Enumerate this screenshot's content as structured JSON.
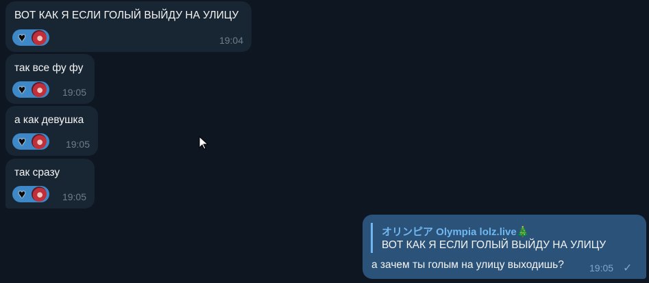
{
  "messages_in": [
    {
      "text": "ВОТ КАК Я ЕСЛИ ГОЛЫЙ ВЫЙДУ НА УЛИЦУ",
      "time": "19:04",
      "reaction": "heart-icon"
    },
    {
      "text": "так все фу фу",
      "time": "19:05",
      "reaction": "heart-icon"
    },
    {
      "text": "а как девушка",
      "time": "19:05",
      "reaction": "heart-icon"
    },
    {
      "text": "так сразу",
      "time": "19:05",
      "reaction": "heart-icon"
    }
  ],
  "message_out": {
    "reply_name": "オリンピア Olympia lolz.live🎄",
    "reply_text": "ВОТ КАК Я ЕСЛИ ГОЛЫЙ ВЫЙДУ НА УЛИЦУ",
    "text": "а зачем ты голым на улицу выходишь?",
    "time": "19:05",
    "status_icon": "check-icon"
  },
  "colors": {
    "background": "#0e1621",
    "incoming_bubble": "#182533",
    "outgoing_bubble": "#2b5278",
    "reaction_pill": "#3e88c7",
    "accent": "#70b7f2"
  }
}
